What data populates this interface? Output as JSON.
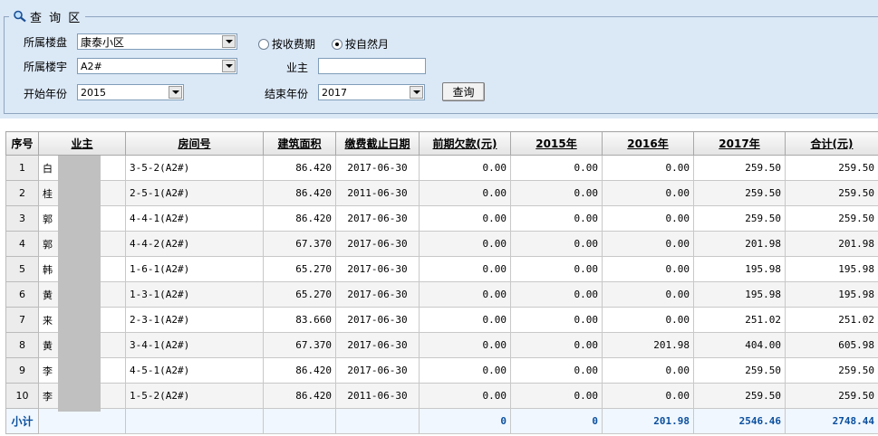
{
  "query": {
    "title": "查 询 区",
    "building_label": "所属楼盘",
    "building_value": "康泰小区",
    "block_label": "所属楼宇",
    "block_value": "A2#",
    "start_year_label": "开始年份",
    "start_year_value": "2015",
    "end_year_label": "结束年份",
    "end_year_value": "2017",
    "owner_label": "业主",
    "owner_value": "",
    "radio_fee_period": "按收费期",
    "radio_natural_month": "按自然月",
    "search_button": "查询"
  },
  "table": {
    "headers": [
      "序号",
      "业主",
      "房间号",
      "建筑面积",
      "缴费截止日期",
      "前期欠款(元)",
      "2015年",
      "2016年",
      "2017年",
      "合计(元)"
    ],
    "rows": [
      {
        "seq": "1",
        "owner": "白",
        "room": "3-5-2(A2#)",
        "area": "86.420",
        "due": "2017-06-30",
        "prior": "0.00",
        "y2015": "0.00",
        "y2016": "0.00",
        "y2017": "259.50",
        "total": "259.50"
      },
      {
        "seq": "2",
        "owner": "桂",
        "room": "2-5-1(A2#)",
        "area": "86.420",
        "due": "2011-06-30",
        "prior": "0.00",
        "y2015": "0.00",
        "y2016": "0.00",
        "y2017": "259.50",
        "total": "259.50"
      },
      {
        "seq": "3",
        "owner": "郭",
        "room": "4-4-1(A2#)",
        "area": "86.420",
        "due": "2017-06-30",
        "prior": "0.00",
        "y2015": "0.00",
        "y2016": "0.00",
        "y2017": "259.50",
        "total": "259.50"
      },
      {
        "seq": "4",
        "owner": "郭",
        "room": "4-4-2(A2#)",
        "area": "67.370",
        "due": "2017-06-30",
        "prior": "0.00",
        "y2015": "0.00",
        "y2016": "0.00",
        "y2017": "201.98",
        "total": "201.98"
      },
      {
        "seq": "5",
        "owner": "韩",
        "room": "1-6-1(A2#)",
        "area": "65.270",
        "due": "2017-06-30",
        "prior": "0.00",
        "y2015": "0.00",
        "y2016": "0.00",
        "y2017": "195.98",
        "total": "195.98"
      },
      {
        "seq": "6",
        "owner": "黄",
        "room": "1-3-1(A2#)",
        "area": "65.270",
        "due": "2017-06-30",
        "prior": "0.00",
        "y2015": "0.00",
        "y2016": "0.00",
        "y2017": "195.98",
        "total": "195.98"
      },
      {
        "seq": "7",
        "owner": "来",
        "room": "2-3-1(A2#)",
        "area": "83.660",
        "due": "2017-06-30",
        "prior": "0.00",
        "y2015": "0.00",
        "y2016": "0.00",
        "y2017": "251.02",
        "total": "251.02"
      },
      {
        "seq": "8",
        "owner": "黄",
        "room": "3-4-1(A2#)",
        "area": "67.370",
        "due": "2017-06-30",
        "prior": "0.00",
        "y2015": "0.00",
        "y2016": "201.98",
        "y2017": "404.00",
        "total": "605.98"
      },
      {
        "seq": "9",
        "owner": "李",
        "room": "4-5-1(A2#)",
        "area": "86.420",
        "due": "2017-06-30",
        "prior": "0.00",
        "y2015": "0.00",
        "y2016": "0.00",
        "y2017": "259.50",
        "total": "259.50"
      },
      {
        "seq": "10",
        "owner": "李",
        "room": "1-5-2(A2#)",
        "area": "86.420",
        "due": "2011-06-30",
        "prior": "0.00",
        "y2015": "0.00",
        "y2016": "0.00",
        "y2017": "259.50",
        "total": "259.50"
      }
    ],
    "subtotal": {
      "label": "小计",
      "prior": "0",
      "y2015": "0",
      "y2016": "201.98",
      "y2017": "2546.46",
      "total": "2748.44"
    }
  },
  "colors": {
    "panel_bg": "#dbe8f6",
    "subtotal_text": "#0a4f9e"
  }
}
